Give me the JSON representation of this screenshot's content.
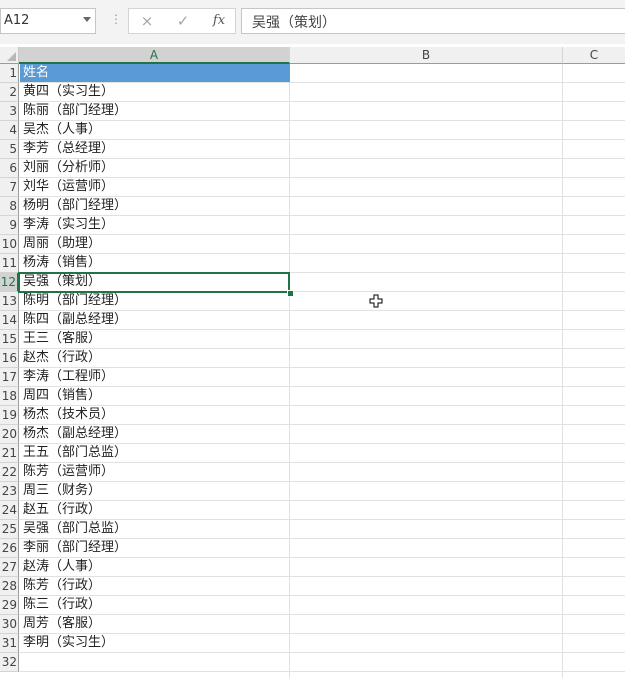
{
  "formula_bar": {
    "name_box": "A12",
    "cancel_icon": "×",
    "enter_icon": "✓",
    "fx_label": "fx",
    "formula": "吴强（策划）"
  },
  "sheet": {
    "columns": [
      "A",
      "B",
      "C"
    ],
    "selected_column": "A",
    "active_cell": "A12",
    "rows": [
      {
        "num": "1",
        "value": "姓名"
      },
      {
        "num": "2",
        "value": "黄四（实习生）"
      },
      {
        "num": "3",
        "value": "陈丽（部门经理）"
      },
      {
        "num": "4",
        "value": "吴杰（人事）"
      },
      {
        "num": "5",
        "value": "李芳（总经理）"
      },
      {
        "num": "6",
        "value": "刘丽（分析师）"
      },
      {
        "num": "7",
        "value": "刘华（运营师）"
      },
      {
        "num": "8",
        "value": "杨明（部门经理）"
      },
      {
        "num": "9",
        "value": "李涛（实习生）"
      },
      {
        "num": "10",
        "value": "周丽（助理）"
      },
      {
        "num": "11",
        "value": "杨涛（销售）"
      },
      {
        "num": "12",
        "value": "吴强（策划）"
      },
      {
        "num": "13",
        "value": "陈明（部门经理）"
      },
      {
        "num": "14",
        "value": "陈四（副总经理）"
      },
      {
        "num": "15",
        "value": "王三（客服）"
      },
      {
        "num": "16",
        "value": "赵杰（行政）"
      },
      {
        "num": "17",
        "value": "李涛（工程师）"
      },
      {
        "num": "18",
        "value": "周四（销售）"
      },
      {
        "num": "19",
        "value": "杨杰（技术员）"
      },
      {
        "num": "20",
        "value": "杨杰（副总经理）"
      },
      {
        "num": "21",
        "value": "王五（部门总监）"
      },
      {
        "num": "22",
        "value": "陈芳（运营师）"
      },
      {
        "num": "23",
        "value": "周三（财务）"
      },
      {
        "num": "24",
        "value": "赵五（行政）"
      },
      {
        "num": "25",
        "value": "吴强（部门总监）"
      },
      {
        "num": "26",
        "value": "李丽（部门经理）"
      },
      {
        "num": "27",
        "value": "赵涛（人事）"
      },
      {
        "num": "28",
        "value": "陈芳（行政）"
      },
      {
        "num": "29",
        "value": "陈三（行政）"
      },
      {
        "num": "30",
        "value": "周芳（客服）"
      },
      {
        "num": "31",
        "value": "李明（实习生）"
      },
      {
        "num": "32",
        "value": ""
      }
    ]
  },
  "colors": {
    "header_fill": "#5b9bd5",
    "selection": "#217346"
  }
}
